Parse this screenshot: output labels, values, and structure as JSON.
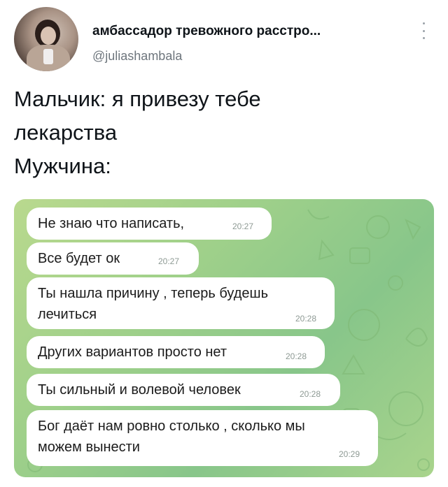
{
  "tweet": {
    "author_name": "амбассадор тревожного расстро...",
    "author_handle": "@juliashambala",
    "text_lines": [
      "Мальчик: я привезу тебе",
      "лекарства",
      "Мужчина:"
    ]
  },
  "chat": {
    "messages": [
      {
        "line1": "Не знаю что написать,",
        "line2": "",
        "time": "20:27"
      },
      {
        "line1": "Все будет ок",
        "line2": "",
        "time": "20:27"
      },
      {
        "line1": "Ты нашла причину , теперь будешь",
        "line2": "лечиться",
        "time": "20:28"
      },
      {
        "line1": "Других вариантов просто нет",
        "line2": "",
        "time": "20:28"
      },
      {
        "line1": "Ты сильный и волевой человек",
        "line2": "",
        "time": "20:28"
      },
      {
        "line1": "Бог даёт нам ровно столько , сколько мы",
        "line2": "можем вынести",
        "time": "20:29"
      }
    ]
  },
  "colors": {
    "chat_background": "#9fd08a",
    "bubble": "#ffffff",
    "handle_text": "#6e767d"
  },
  "icons": {
    "more": "more-vertical-icon"
  }
}
